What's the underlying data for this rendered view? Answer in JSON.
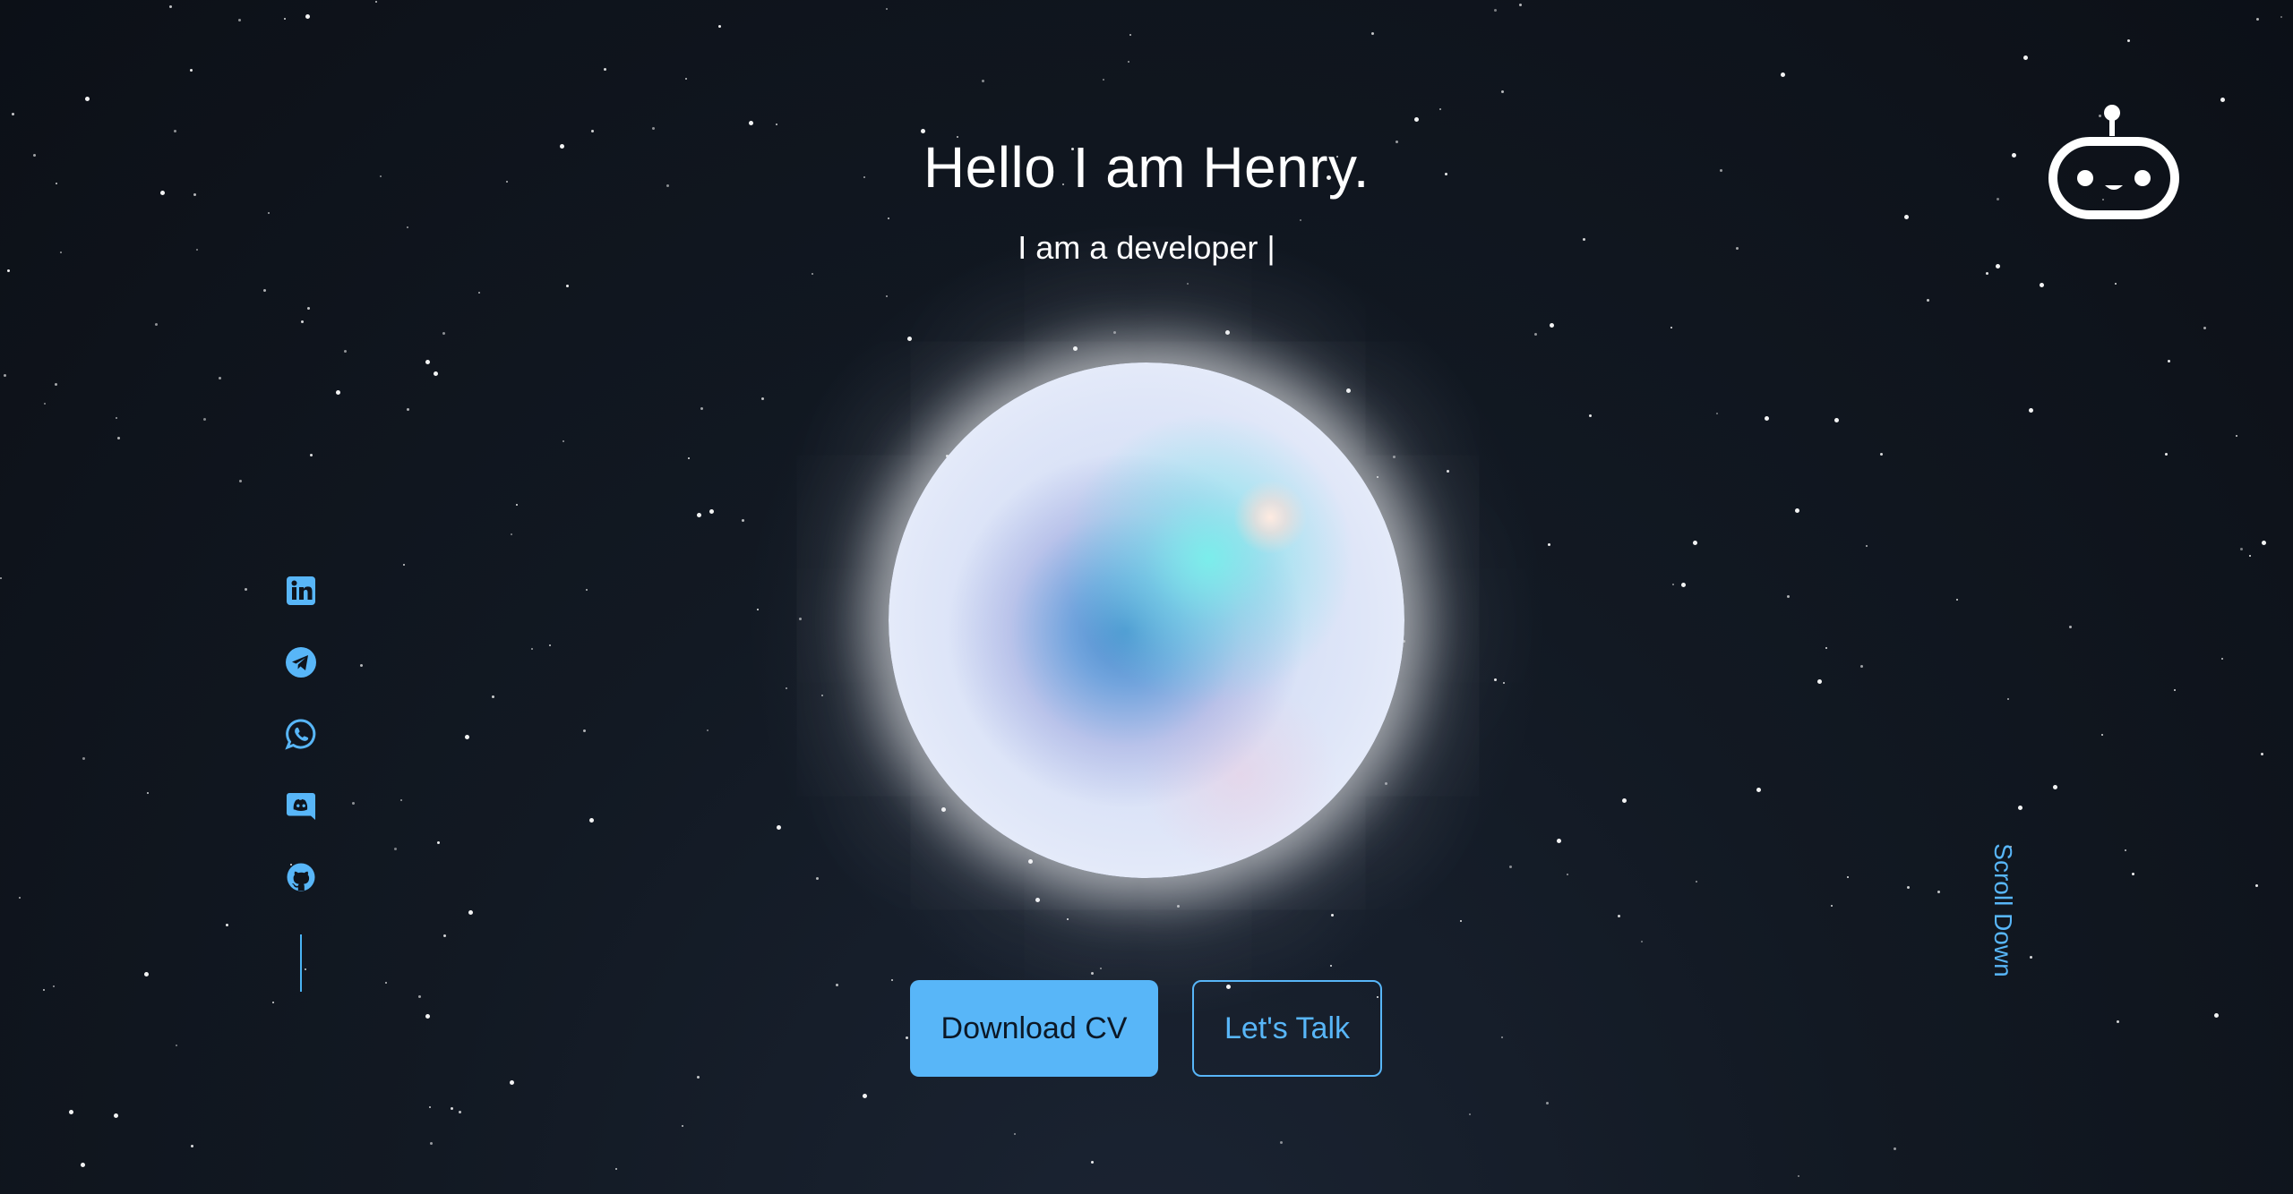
{
  "hero": {
    "title": "Hello I am Henry.",
    "subtitle": "I am a developer |"
  },
  "logo": {
    "icon": "robot-icon"
  },
  "social": [
    {
      "name": "linkedin-icon"
    },
    {
      "name": "telegram-icon"
    },
    {
      "name": "whatsapp-icon"
    },
    {
      "name": "discord-icon"
    },
    {
      "name": "github-icon"
    }
  ],
  "buttons": {
    "download_cv": "Download CV",
    "lets_talk": "Let's Talk"
  },
  "scroll": {
    "label": "Scroll Down"
  },
  "colors": {
    "accent": "#58b6f8",
    "background": "#0f141d",
    "text": "#ffffff"
  }
}
